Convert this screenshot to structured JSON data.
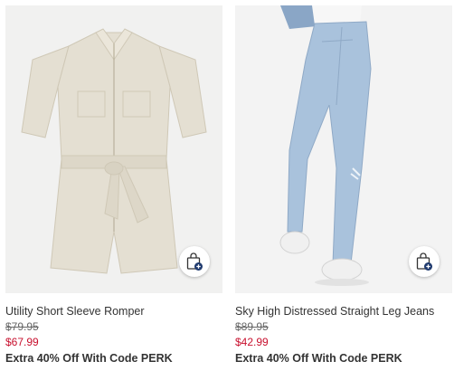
{
  "products": [
    {
      "name": "Utility Short Sleeve Romper",
      "original_price": "$79.95",
      "sale_price": "$67.99",
      "promo": "Extra 40% Off With Code PERK",
      "quick_add_icon": "shopping-bag-plus-icon"
    },
    {
      "name": "Sky High Distressed Straight Leg Jeans",
      "original_price": "$89.95",
      "sale_price": "$42.99",
      "promo": "Extra 40% Off With Code PERK",
      "quick_add_icon": "shopping-bag-plus-icon"
    }
  ],
  "colors": {
    "sale_price": "#c8102e",
    "quick_add_badge": "#1f3a6e"
  }
}
